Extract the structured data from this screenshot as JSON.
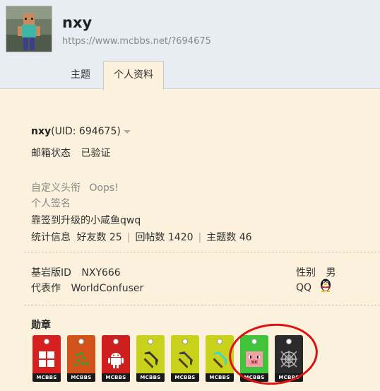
{
  "profile": {
    "name": "nxy",
    "url": "https://www.mcbbs.net/?694675"
  },
  "tabs": [
    {
      "label": "主题"
    },
    {
      "label": "个人资料"
    }
  ],
  "info": {
    "name_bold": "nxy",
    "uid_text": "(UID: 694675)",
    "email_label": "邮箱状态",
    "email_value": "已验证",
    "custom_title_label": "自定义头衔",
    "custom_title_value": "Oops!",
    "signature_label": "个人签名",
    "signature_value": "靠签到升级的小咸鱼qwq",
    "stats_label": "统计信息",
    "friends": "好友数 25",
    "replies": "回帖数 1420",
    "topics": "主题数 46",
    "bedrock_label": "基岩版ID",
    "bedrock_value": "NXY666",
    "works_label": "代表作",
    "works_value": "WorldConfuser",
    "gender_label": "性别",
    "gender_value": "男",
    "qq_label": "QQ",
    "sep": "|"
  },
  "medals": {
    "label": "勋章",
    "band_text": "MCBBS",
    "items": [
      {
        "icon": "windows-icon",
        "color": "#d61f1f"
      },
      {
        "icon": "leaf-icon",
        "color": "#d2531a"
      },
      {
        "icon": "android-icon",
        "color": "#cf1e1e"
      },
      {
        "icon": "pickaxe-icon",
        "color": "#c8d21a"
      },
      {
        "icon": "pickaxe-icon",
        "color": "#c8d21a"
      },
      {
        "icon": "diamond-pickaxe-icon",
        "color": "#c8d21a"
      },
      {
        "icon": "pig-icon",
        "color": "#3fc43a"
      },
      {
        "icon": "cobweb-icon",
        "color": "#2b2b2b"
      }
    ]
  }
}
